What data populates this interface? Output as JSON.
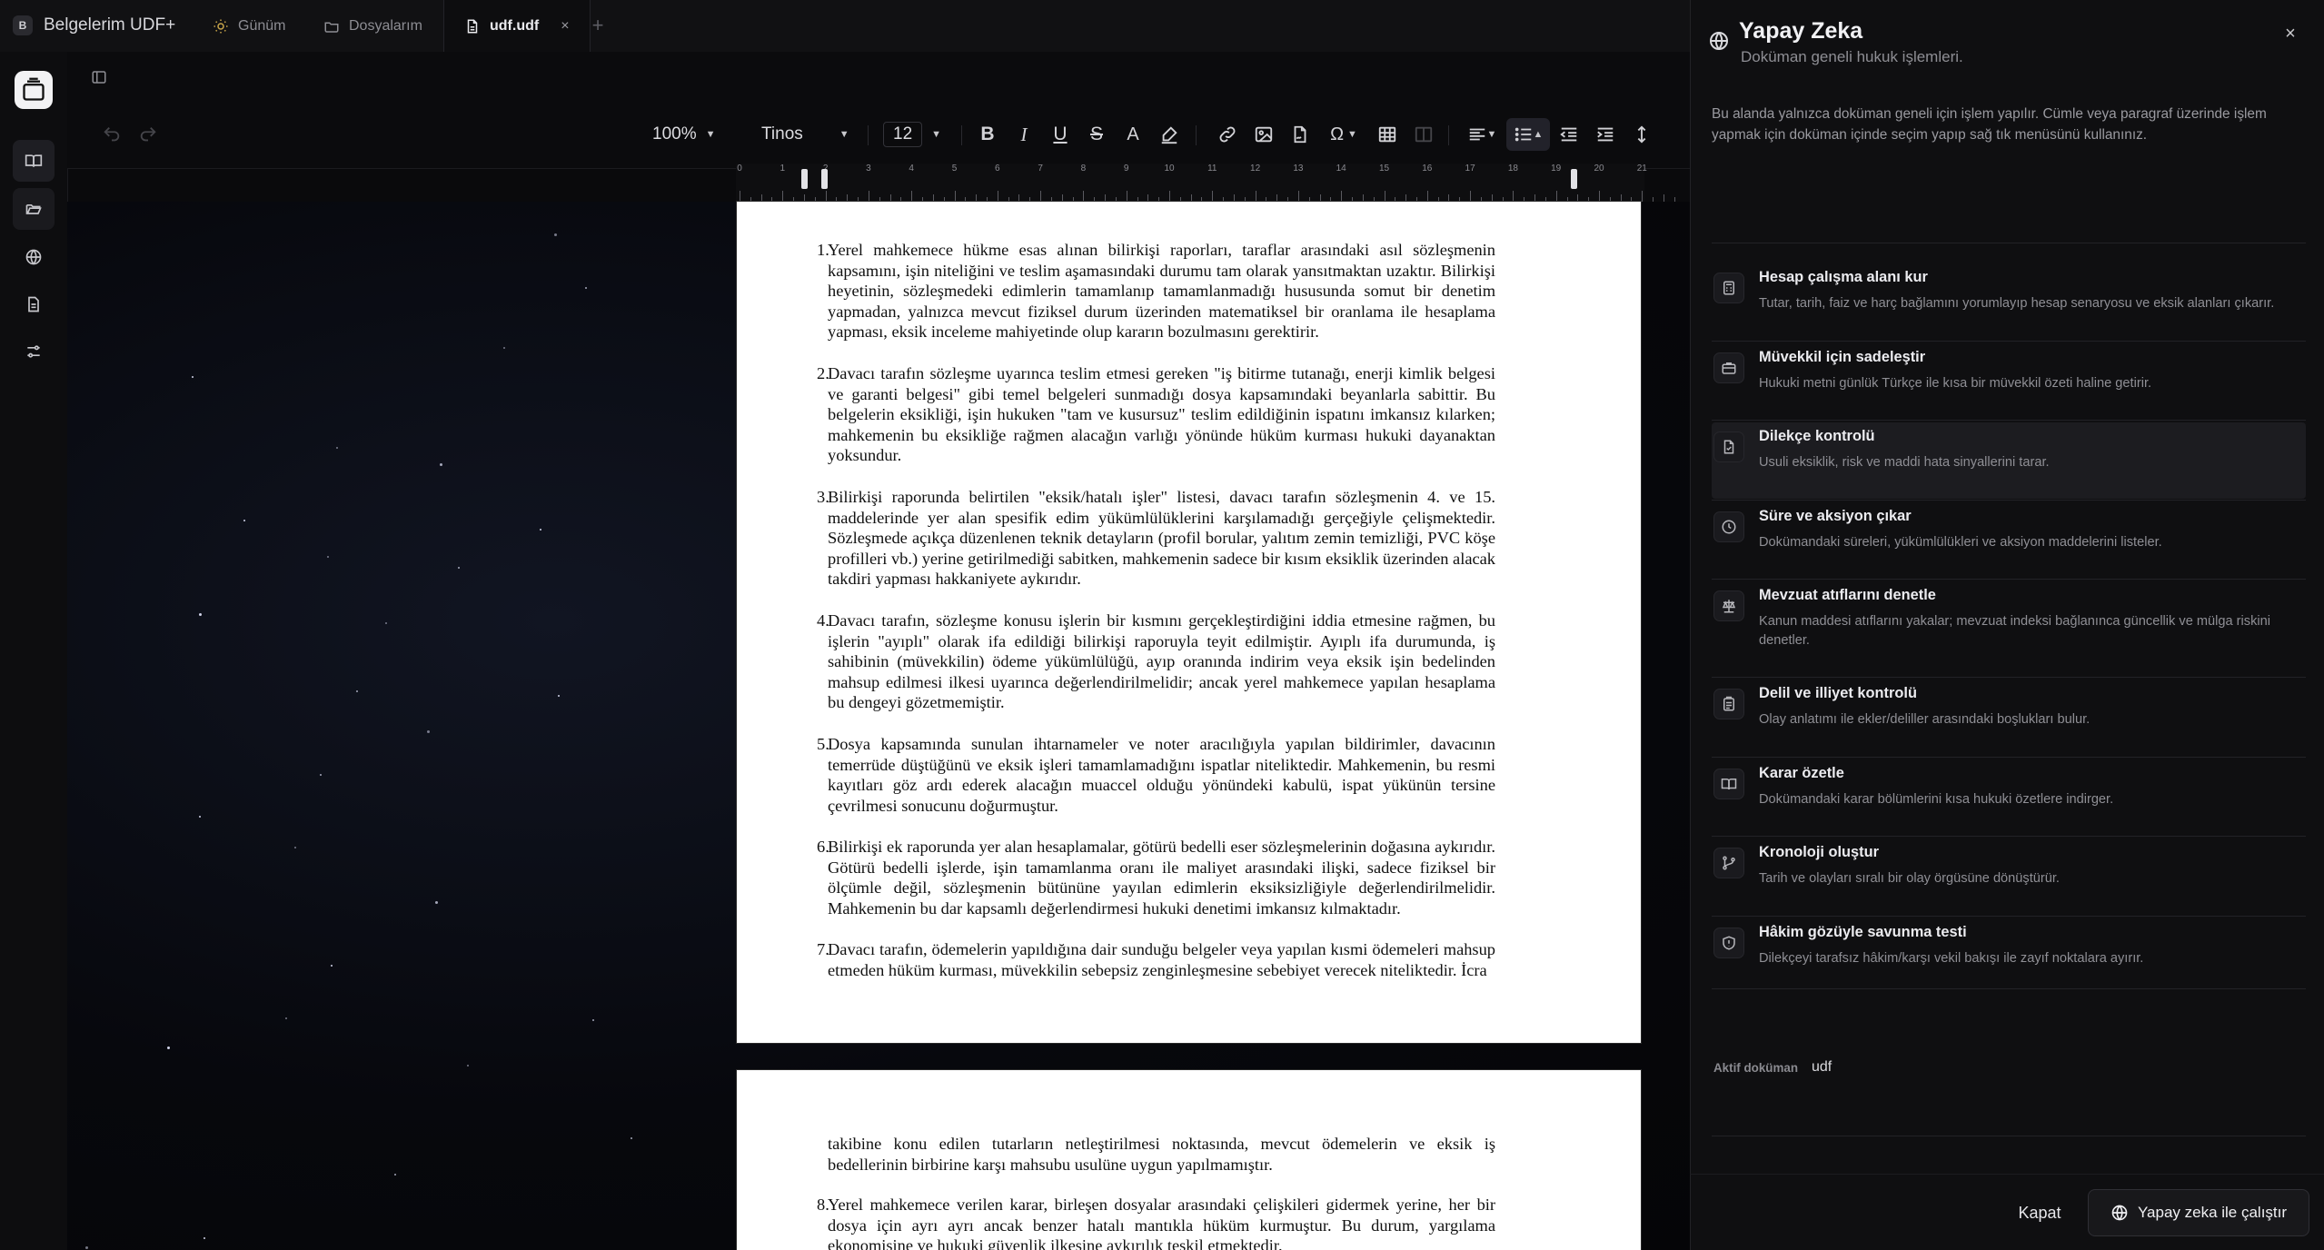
{
  "app": {
    "badge": "B",
    "title": "Belgelerim UDF+"
  },
  "tabs": [
    {
      "label": "Günüm",
      "icon": "sun-icon"
    },
    {
      "label": "Dosyalarım",
      "icon": "folder-icon"
    },
    {
      "label": "udf.udf",
      "icon": "file-icon",
      "active": true,
      "close": "×"
    }
  ],
  "tab_add": "+",
  "toolbar": {
    "zoom": "100%",
    "font": "Tinos",
    "font_size": "12"
  },
  "ruler": {
    "labels": [
      "0",
      "1",
      "2",
      "3",
      "4",
      "5",
      "6",
      "7",
      "8",
      "9",
      "10",
      "11",
      "12",
      "13",
      "14",
      "15",
      "16",
      "17",
      "18",
      "19",
      "20",
      "21"
    ]
  },
  "document": {
    "page1": [
      {
        "num": "1.",
        "text": "Yerel mahkemece hükme esas alınan bilirkişi raporları, taraflar arasındaki asıl sözleşmenin kapsamını, işin niteliğini ve teslim aşamasındaki durumu tam olarak yansıtmaktan uzaktır. Bilirkişi heyetinin, sözleşmedeki edimlerin tamamlanıp tamamlanmadığı hususunda somut bir denetim yapmadan, yalnızca mevcut fiziksel durum üzerinden matematiksel bir oranlama ile hesaplama yapması, eksik inceleme mahiyetinde olup kararın bozulmasını gerektirir."
      },
      {
        "num": "2.",
        "text": "Davacı tarafın sözleşme uyarınca teslim etmesi gereken \"iş bitirme tutanağı, enerji kimlik belgesi ve garanti belgesi\" gibi temel belgeleri sunmadığı dosya kapsamındaki beyanlarla sabittir. Bu belgelerin eksikliği, işin hukuken \"tam ve kusursuz\" teslim edildiğinin ispatını imkansız kılarken; mahkemenin bu eksikliğe rağmen alacağın varlığı yönünde hüküm kurması hukuki dayanaktan yoksundur."
      },
      {
        "num": "3.",
        "text": "Bilirkişi raporunda belirtilen \"eksik/hatalı işler\" listesi, davacı tarafın sözleşmenin 4. ve 15. maddelerinde yer alan spesifik edim yükümlülüklerini karşılamadığı gerçeğiyle çelişmektedir. Sözleşmede açıkça düzenlenen teknik detayların (profil borular, yalıtım zemin temizliği, PVC köşe profilleri vb.) yerine getirilmediği sabitken, mahkemenin sadece bir kısım eksiklik üzerinden alacak takdiri yapması hakkaniyete aykırıdır."
      },
      {
        "num": "4.",
        "text": "Davacı tarafın, sözleşme konusu işlerin bir kısmını gerçekleştirdiğini iddia etmesine rağmen, bu işlerin \"ayıplı\" olarak ifa edildiği bilirkişi raporuyla teyit edilmiştir. Ayıplı ifa durumunda, iş sahibinin (müvekkilin) ödeme yükümlülüğü, ayıp oranında indirim veya eksik işin bedelinden mahsup edilmesi ilkesi uyarınca değerlendirilmelidir; ancak yerel mahkemece yapılan hesaplama bu dengeyi gözetmemiştir."
      },
      {
        "num": "5.",
        "text": "Dosya kapsamında sunulan ihtarnameler ve noter aracılığıyla yapılan bildirimler, davacının temerrüde düştüğünü ve eksik işleri tamamlamadığını ispatlar niteliktedir. Mahkemenin, bu resmi kayıtları göz ardı ederek alacağın muaccel olduğu yönündeki kabulü, ispat yükünün tersine çevrilmesi sonucunu doğurmuştur."
      },
      {
        "num": "6.",
        "text": "Bilirkişi ek raporunda yer alan hesaplamalar, götürü bedelli eser sözleşmelerinin doğasına aykırıdır. Götürü bedelli işlerde, işin tamamlanma oranı ile maliyet arasındaki ilişki, sadece fiziksel bir ölçümle değil, sözleşmenin bütününe yayılan edimlerin eksiksizliğiyle değerlendirilmelidir. Mahkemenin bu dar kapsamlı değerlendirmesi hukuki denetimi imkansız kılmaktadır."
      },
      {
        "num": "7.",
        "text": "Davacı tarafın, ödemelerin yapıldığına dair sunduğu belgeler veya yapılan kısmi ödemeleri mahsup etmeden hüküm kurması, müvekkilin sebepsiz zenginleşmesine sebebiyet verecek niteliktedir. İcra"
      }
    ],
    "page2": [
      {
        "num": "",
        "text": "takibine konu edilen tutarların netleştirilmesi noktasında, mevcut ödemelerin ve eksik iş bedellerinin birbirine karşı mahsubu usulüne uygun yapılmamıştır."
      },
      {
        "num": "8.",
        "text": "Yerel mahkemece verilen karar, birleşen dosyalar arasındaki çelişkileri gidermek yerine, her bir dosya için ayrı ayrı ancak benzer hatalı mantıkla hüküm kurmuştur. Bu durum, yargılama ekonomisine ve hukuki güvenlik ilkesine aykırılık teşkil etmektedir."
      }
    ]
  },
  "ai_panel": {
    "title": "Yapay Zeka",
    "subtitle": "Doküman geneli hukuk işlemleri.",
    "info": "Bu alanda yalnızca doküman geneli için işlem yapılır. Cümle veya paragraf üzerinde işlem yapmak için doküman içinde seçim yapıp sağ tık menüsünü kullanınız.",
    "actions": [
      {
        "title": "Hesap çalışma alanı kur",
        "desc": "Tutar, tarih, faiz ve harç bağlamını yorumlayıp hesap senaryosu ve eksik alanları çıkarır.",
        "icon": "calculator-icon"
      },
      {
        "title": "Müvekkil için sadeleştir",
        "desc": "Hukuki metni günlük Türkçe ile kısa bir müvekkil özeti haline getirir.",
        "icon": "briefcase-icon"
      },
      {
        "title": "Dilekçe kontrolü",
        "desc": "Usuli eksiklik, risk ve maddi hata sinyallerini tarar.",
        "icon": "file-check-icon",
        "highlighted": true
      },
      {
        "title": "Süre ve aksiyon çıkar",
        "desc": "Dokümandaki süreleri, yükümlülükleri ve aksiyon maddelerini listeler.",
        "icon": "clock-icon"
      },
      {
        "title": "Mevzuat atıflarını denetle",
        "desc": "Kanun maddesi atıflarını yakalar; mevzuat indeksi bağlanınca güncellik ve mülga riskini denetler.",
        "icon": "scale-icon"
      },
      {
        "title": "Delil ve illiyet kontrolü",
        "desc": "Olay anlatımı ile ekler/deliller arasındaki boşlukları bulur.",
        "icon": "clipboard-icon"
      },
      {
        "title": "Karar özetle",
        "desc": "Dokümandaki karar bölümlerini kısa hukuki özetlere indirger.",
        "icon": "book-open-icon"
      },
      {
        "title": "Kronoloji oluştur",
        "desc": "Tarih ve olayları sıralı bir olay örgüsüne dönüştürür.",
        "icon": "git-branch-icon"
      },
      {
        "title": "Hâkim gözüyle savunma testi",
        "desc": "Dilekçeyi tarafsız hâkim/karşı vekil bakışı ile zayıf noktalara ayırır.",
        "icon": "shield-icon"
      }
    ],
    "active_doc_label": "Aktif doküman",
    "active_doc_value": "udf",
    "close_label": "Kapat",
    "run_label": "Yapay zeka ile çalıştır",
    "close_x": "×"
  },
  "colors": {
    "panel_bg": "#0f0f11",
    "highlight": "#1c1c20",
    "page": "#ffffff"
  }
}
